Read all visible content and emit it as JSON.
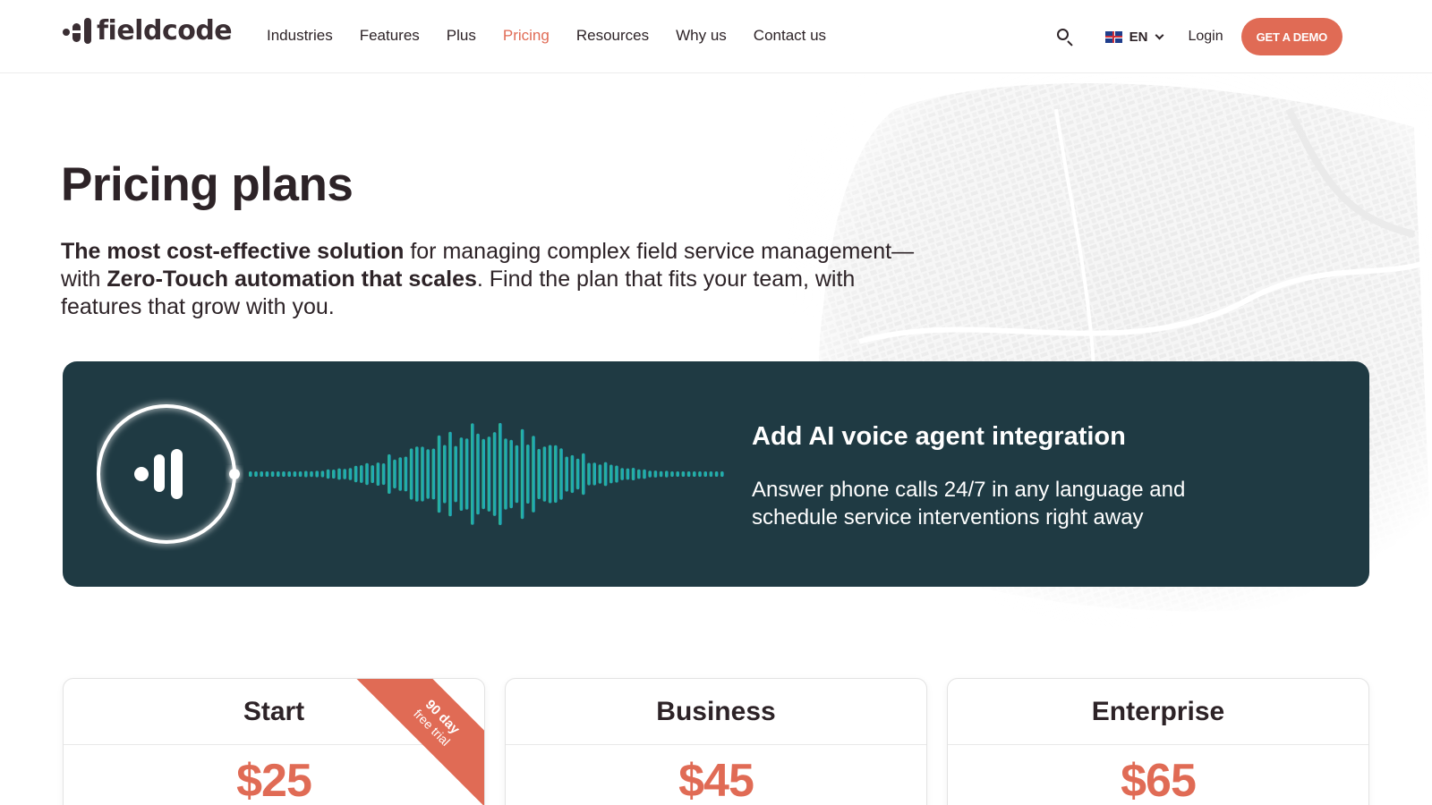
{
  "brand": {
    "name": "fieldcode",
    "logo_icon": "fieldcode-mark-icon"
  },
  "nav": {
    "items": [
      {
        "label": "Industries",
        "active": false
      },
      {
        "label": "Features",
        "active": false
      },
      {
        "label": "Plus",
        "active": false
      },
      {
        "label": "Pricing",
        "active": true
      },
      {
        "label": "Resources",
        "active": false
      },
      {
        "label": "Why us",
        "active": false
      },
      {
        "label": "Contact us",
        "active": false
      }
    ]
  },
  "header": {
    "search_icon": "search-icon",
    "language": {
      "flag": "uk-flag-icon",
      "code": "EN",
      "chevron": "chevron-down-icon"
    },
    "login_label": "Login",
    "demo_label": "GET A DEMO"
  },
  "hero": {
    "title": "Pricing plans",
    "desc_bold_1": "The most cost-effective solution",
    "desc_text_1": " for managing complex field service management—with ",
    "desc_bold_2": "Zero-Touch automation that scales",
    "desc_text_2": ". Find the plan that fits your team, with features that grow with you."
  },
  "banner": {
    "title": "Add AI voice agent integration",
    "description": "Answer phone calls 24/7 in any language and schedule service interventions right away",
    "graphic": "voice-waveform-icon"
  },
  "plans": [
    {
      "name": "Start",
      "price": "$25",
      "ribbon_line1": "90 day",
      "ribbon_line2": "free trial"
    },
    {
      "name": "Business",
      "price": "$45"
    },
    {
      "name": "Enterprise",
      "price": "$65"
    }
  ],
  "colors": {
    "accent": "#e06b55",
    "text": "#2d2327",
    "banner_bg": "#1f3a43",
    "wave_start": "#2fb58a",
    "wave_end": "#1aa3c7"
  }
}
